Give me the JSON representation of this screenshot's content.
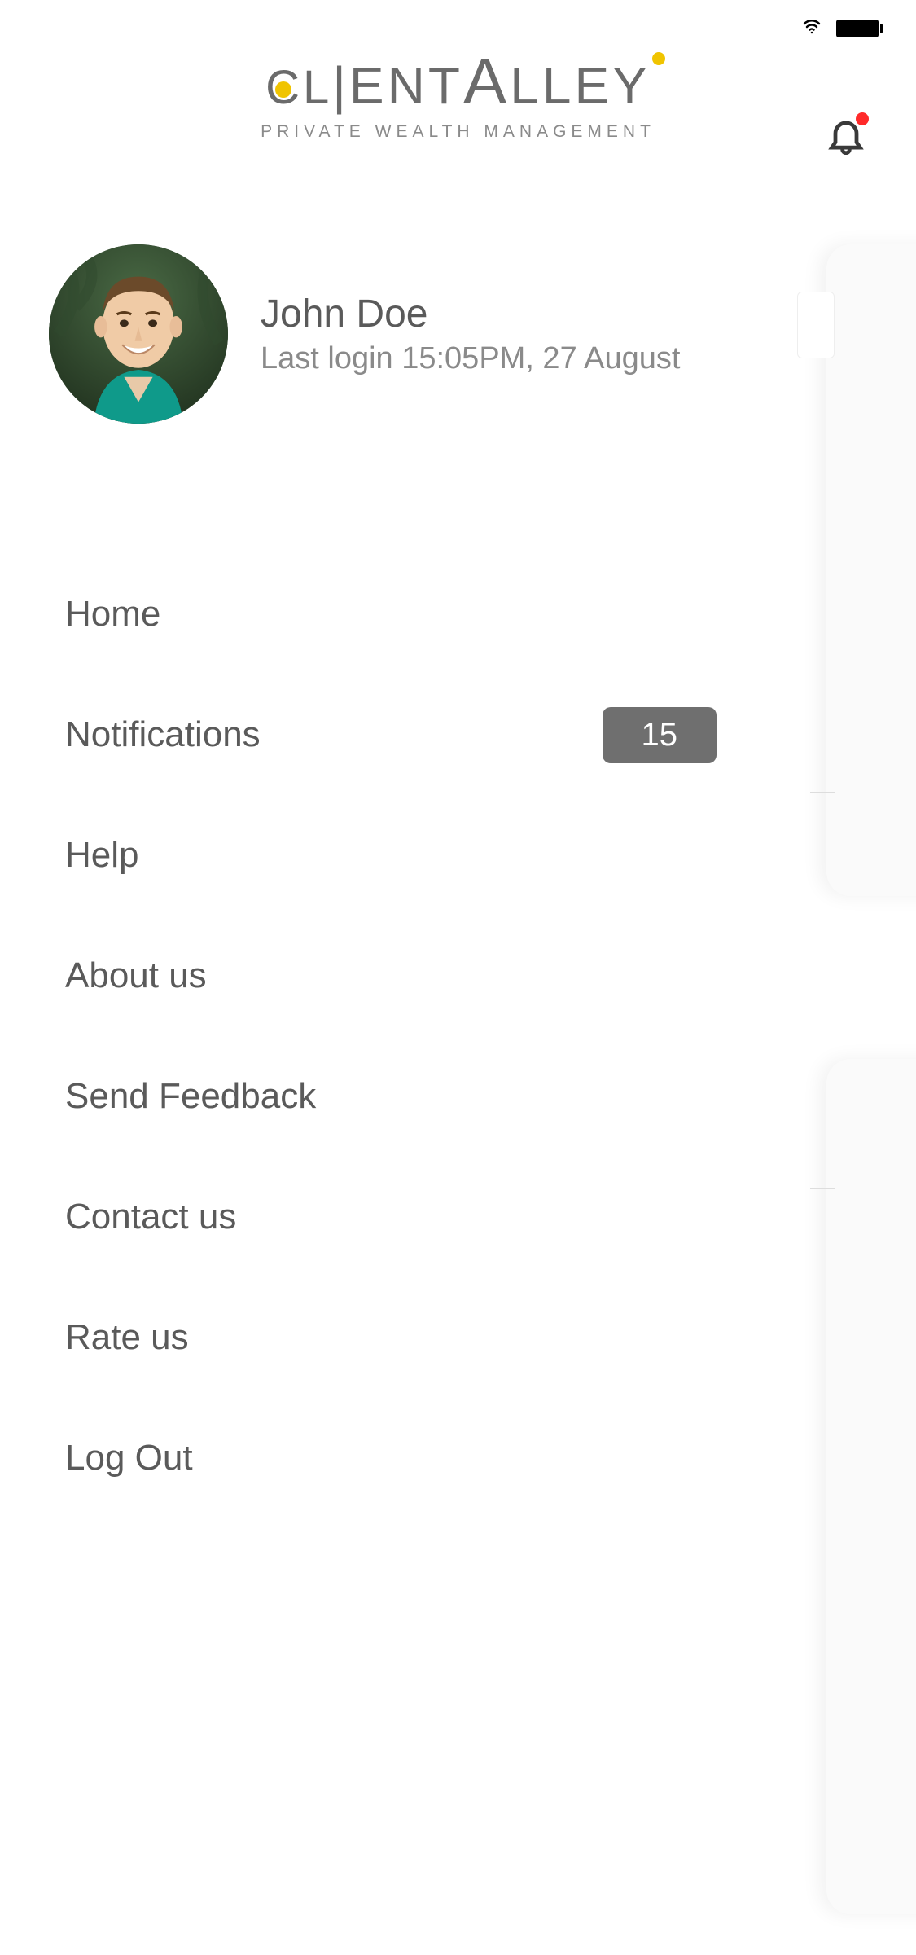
{
  "brand": {
    "name": "CLIENTALLEY",
    "tagline": "PRIVATE WEALTH MANAGEMENT"
  },
  "notifications": {
    "has_unread": true
  },
  "profile": {
    "name": "John Doe",
    "last_login": "Last login 15:05PM, 27 August"
  },
  "menu": [
    {
      "label": "Home",
      "badge": null
    },
    {
      "label": "Notifications",
      "badge": "15"
    },
    {
      "label": "Help",
      "badge": null
    },
    {
      "label": "About us",
      "badge": null
    },
    {
      "label": "Send Feedback",
      "badge": null
    },
    {
      "label": "Contact us",
      "badge": null
    },
    {
      "label": "Rate us",
      "badge": null
    },
    {
      "label": "Log Out",
      "badge": null
    }
  ]
}
